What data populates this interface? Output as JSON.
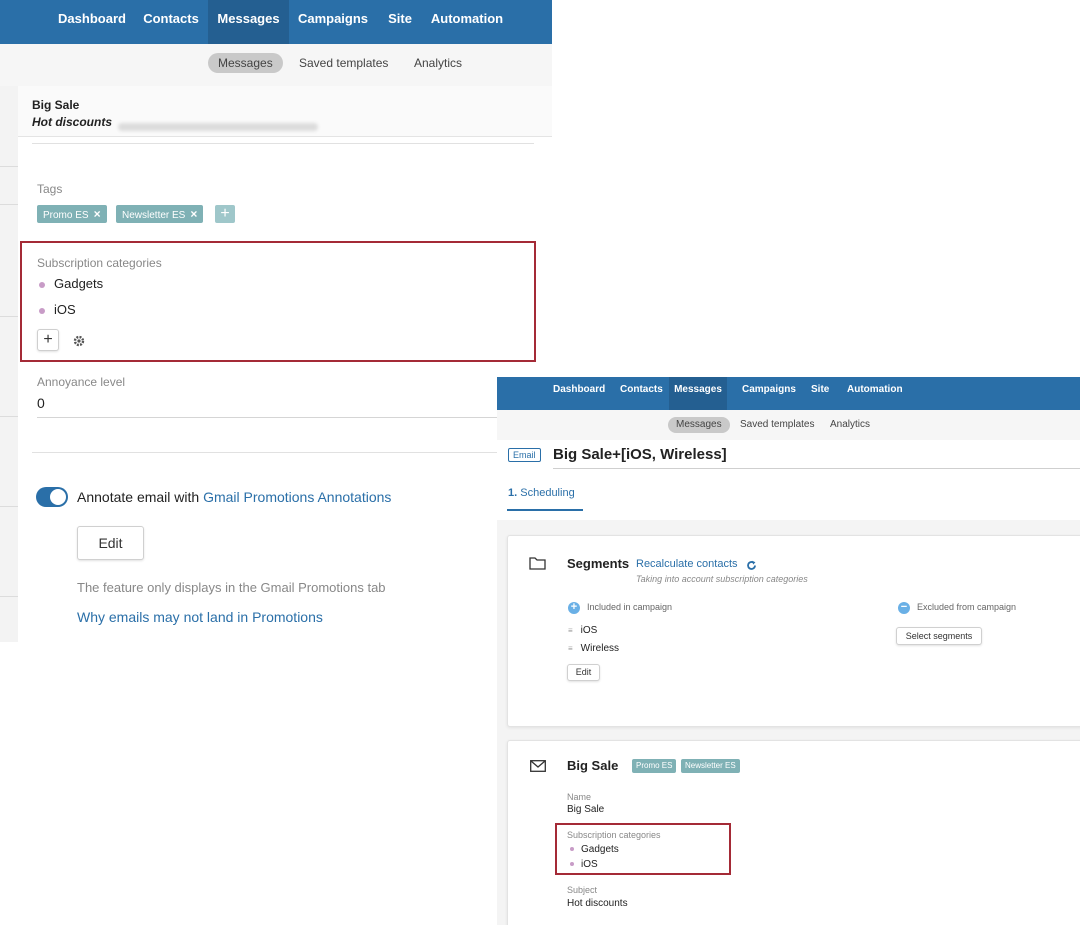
{
  "left": {
    "nav": {
      "items": [
        "Dashboard",
        "Contacts",
        "Messages",
        "Campaigns",
        "Site",
        "Automation"
      ],
      "active": "Messages"
    },
    "subnav": {
      "items": [
        "Messages",
        "Saved templates",
        "Analytics"
      ],
      "active": "Messages"
    },
    "message": {
      "title": "Big Sale",
      "subject": "Hot discounts"
    },
    "tags": {
      "label": "Tags",
      "items": [
        "Promo ES",
        "Newsletter ES"
      ],
      "remove_icon": "×",
      "add_icon": "+"
    },
    "subscription_categories": {
      "label": "Subscription categories",
      "items": [
        "Gadgets",
        "iOS"
      ],
      "add_icon": "+",
      "settings_icon": "gear-icon"
    },
    "annoyance": {
      "label": "Annoyance level",
      "value": "0"
    },
    "annotate": {
      "toggle_on": true,
      "text": "Annotate email with",
      "link": "Gmail Promotions Annotations",
      "edit_label": "Edit",
      "note": "The feature only displays in the Gmail Promotions tab",
      "help_link": "Why emails may not land in Promotions"
    }
  },
  "right": {
    "nav": {
      "items": [
        "Dashboard",
        "Contacts",
        "Messages",
        "Campaigns",
        "Site",
        "Automation"
      ],
      "active": "Messages"
    },
    "subnav": {
      "items": [
        "Messages",
        "Saved templates",
        "Analytics"
      ],
      "active": "Messages"
    },
    "campaign": {
      "badge": "Email",
      "title": "Big Sale+[iOS, Wireless]"
    },
    "step": {
      "number": "1.",
      "label": "Scheduling"
    },
    "segments": {
      "title": "Segments",
      "recalc_link": "Recalculate contacts",
      "recalc_note": "Taking into account subscription categories",
      "included_label": "Included in campaign",
      "included_items": [
        "iOS",
        "Wireless"
      ],
      "edit_label": "Edit",
      "excluded_label": "Excluded from campaign",
      "select_label": "Select segments"
    },
    "message_card": {
      "title": "Big Sale",
      "tags": [
        "Promo ES",
        "Newsletter ES"
      ],
      "name_label": "Name",
      "name_value": "Big Sale",
      "categories_label": "Subscription categories",
      "categories": [
        "Gadgets",
        "iOS"
      ],
      "subject_label": "Subject",
      "subject_value": "Hot discounts"
    }
  },
  "colors": {
    "nav_bg": "#2a6fa8",
    "tag_bg": "#7fb1b5",
    "highlight_border": "#a42a36",
    "bullet": "#c89cc7",
    "link": "#2a6fa8"
  }
}
